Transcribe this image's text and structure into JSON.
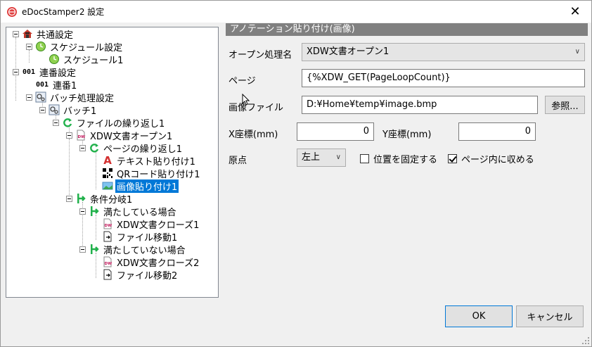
{
  "window": {
    "title": "eDocStamper2 設定",
    "close_glyph": "✕"
  },
  "tree": {
    "nodes": [
      {
        "label": "共通設定",
        "icon": "house-icon"
      },
      {
        "label": "スケジュール設定",
        "icon": "clock-icon"
      },
      {
        "label": "スケジュール1",
        "icon": "clock-icon"
      },
      {
        "label": "連番設定",
        "icon": "number-icon",
        "icon_text": "001"
      },
      {
        "label": "連番1",
        "icon": "number-icon",
        "icon_text": "001"
      },
      {
        "label": "バッチ処理設定",
        "icon": "gears-icon"
      },
      {
        "label": "バッチ1",
        "icon": "gears-icon"
      },
      {
        "label": "ファイルの繰り返し1",
        "icon": "loop-icon"
      },
      {
        "label": "XDW文書オープン1",
        "icon": "xdw-doc-icon"
      },
      {
        "label": "ページの繰り返し1",
        "icon": "loop-icon"
      },
      {
        "label": "テキスト貼り付け1",
        "icon": "text-a-icon",
        "icon_text": "A"
      },
      {
        "label": "QRコード貼り付け1",
        "icon": "qr-code-icon"
      },
      {
        "label": "画像貼り付け1",
        "icon": "image-icon",
        "selected": true
      },
      {
        "label": "条件分岐1",
        "icon": "branch-icon"
      },
      {
        "label": "満たしている場合",
        "icon": "branch-icon"
      },
      {
        "label": "XDW文書クローズ1",
        "icon": "xdw-doc-icon"
      },
      {
        "label": "ファイル移動1",
        "icon": "file-move-icon"
      },
      {
        "label": "満たしていない場合",
        "icon": "branch-icon"
      },
      {
        "label": "XDW文書クローズ2",
        "icon": "xdw-doc-icon"
      },
      {
        "label": "ファイル移動2",
        "icon": "file-move-icon"
      }
    ]
  },
  "panel": {
    "header": "アノテーション貼り付け(画像)",
    "open_process_label": "オープン処理名",
    "open_process_value": "XDW文書オープン1",
    "page_label": "ページ",
    "page_value": "{%XDW_GET(PageLoopCount)}",
    "image_file_label": "画像ファイル",
    "image_file_value": "D:¥Home¥temp¥image.bmp",
    "browse_button": "参照...",
    "x_label": "X座標(mm)",
    "x_value": "0",
    "y_label": "Y座標(mm)",
    "y_value": "0",
    "origin_label": "原点",
    "origin_value": "左上",
    "fix_position_label": "位置を固定する",
    "fix_position_checked": false,
    "fit_in_page_label": "ページ内に収める",
    "fit_in_page_checked": true
  },
  "footer": {
    "ok_label": "OK",
    "cancel_label": "キャンセル"
  },
  "colors": {
    "selection": "#0078d7",
    "header_bg": "#808080",
    "tree_green": "#22b14c"
  }
}
